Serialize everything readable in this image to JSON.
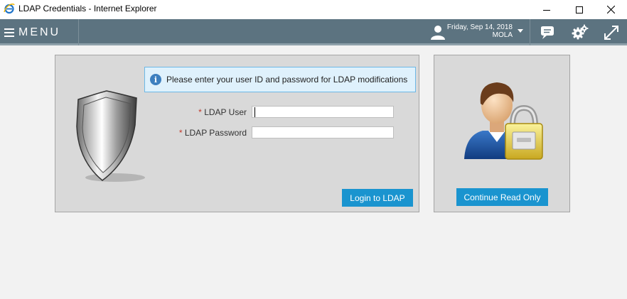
{
  "window": {
    "title": "LDAP Credentials - Internet Explorer"
  },
  "header": {
    "menu_label": "MENU",
    "date": "Friday, Sep 14, 2018",
    "username": "MOLA"
  },
  "login_panel": {
    "info_message": "Please enter your user ID and password for LDAP modifications",
    "fields": {
      "user": {
        "required_mark": "*",
        "label": "LDAP User",
        "value": ""
      },
      "password": {
        "required_mark": "*",
        "label": "LDAP Password",
        "value": ""
      }
    },
    "login_button": "Login to LDAP"
  },
  "readonly_panel": {
    "continue_button": "Continue Read Only"
  },
  "colors": {
    "header_bg": "#5c7380",
    "button_bg": "#1a94cf",
    "panel_bg": "#d9d9d9",
    "info_bg": "#dff1fc"
  }
}
